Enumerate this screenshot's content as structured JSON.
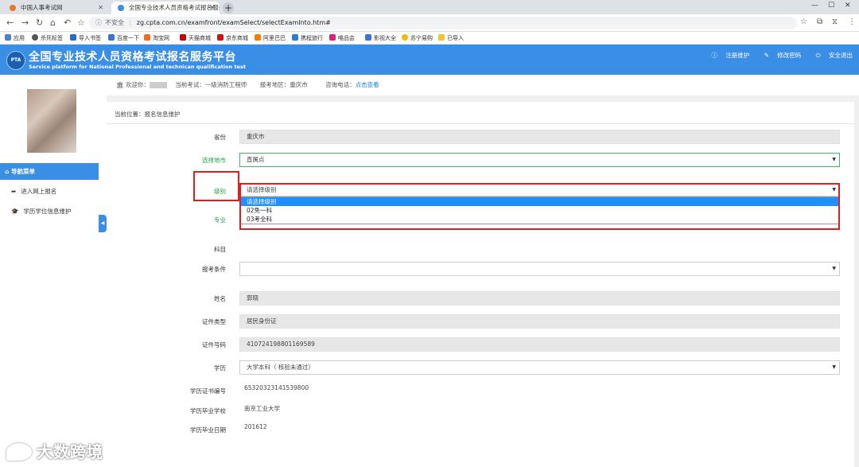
{
  "browser": {
    "tabs": [
      {
        "title": "中国人事考试网",
        "active": false,
        "color": "#e8772e"
      },
      {
        "title": "全国专业技术人员资格考试报名服务平台",
        "active": true,
        "color": "#3a8ee6"
      }
    ],
    "not_secure": "不安全",
    "url": "zg.cpta.com.cn/examfront/examSelect/selectExamInto.htm#",
    "bookmarks": [
      "应用",
      "杀死标签",
      "导入书签",
      "百度一下",
      "淘宝网",
      "天猫商城",
      "京东商城",
      "阿里巴巴",
      "携程旅行",
      "唯品会",
      "影视大全",
      "苏宁易购",
      "已导入"
    ]
  },
  "site": {
    "logo_text": "PTA",
    "title": "全国专业技术人员资格考试报名服务平台",
    "subtitle": "Service platform for National Professional and technican qualification test",
    "links": [
      "注册维护",
      "修改密码",
      "安全退出"
    ]
  },
  "sidebar": {
    "nav_header": "导航菜单",
    "items": [
      "进入网上报名",
      "学历学位信息维护"
    ]
  },
  "info": {
    "welcome": "欢迎你：",
    "exam": "当前考试：一级消防工程师",
    "region": "报考地区：重庆市",
    "phone_label": "咨询电话：",
    "phone_link": "点击查看"
  },
  "crumb": "当前位置：报名信息维护",
  "form": {
    "province": {
      "label": "省份",
      "value": "重庆市"
    },
    "city": {
      "label": "选择地市",
      "value": "直属点"
    },
    "level": {
      "label": "级别",
      "value": "请选择级别",
      "options": [
        "请选择级别",
        "02免一科",
        "03考全科"
      ]
    },
    "major": {
      "label": "专业"
    },
    "subject": {
      "label": "科目"
    },
    "condition": {
      "label": "报考条件",
      "value": ""
    },
    "name": {
      "label": "姓名",
      "value": "郭晓"
    },
    "id_type": {
      "label": "证件类型",
      "value": "居民身份证"
    },
    "id_number": {
      "label": "证件号码",
      "value": "410724198801169589"
    },
    "education": {
      "label": "学历",
      "value": "大学本科（ 核验未通过）"
    },
    "edu_cert": {
      "label": "学历证书编号",
      "value": "65320323141539800"
    },
    "school": {
      "label": "学历毕业学校",
      "value": "南京工业大学"
    },
    "grad_date": {
      "label": "学历毕业日期",
      "value": "201612"
    }
  },
  "watermark": "大数跨境",
  "colors": {
    "header_blue": "#3a8ee6",
    "label_green": "#1ea34a",
    "highlight_red": "#e01e1e",
    "select_blue": "#1e90ff"
  }
}
